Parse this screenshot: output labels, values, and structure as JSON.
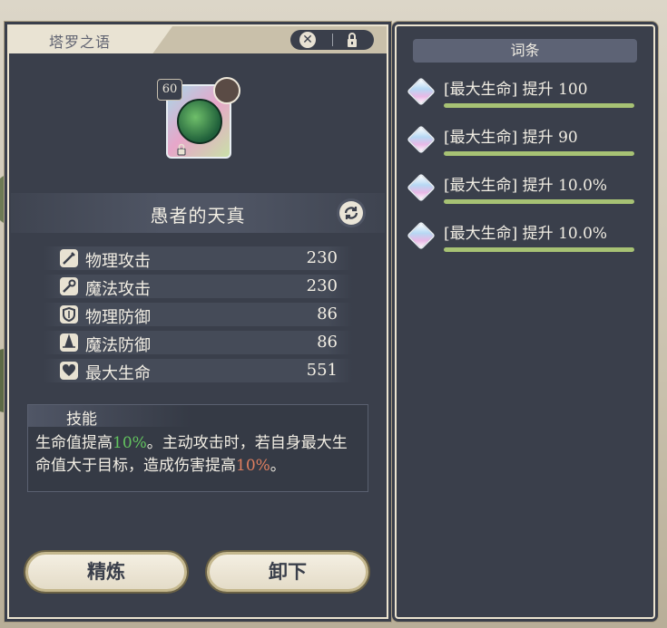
{
  "item": {
    "category": "塔罗之语",
    "level": "60",
    "name": "愚者的天真"
  },
  "stats": [
    {
      "icon": "sword-icon",
      "label": "物理攻击",
      "value": "230"
    },
    {
      "icon": "staff-icon",
      "label": "魔法攻击",
      "value": "230"
    },
    {
      "icon": "shield-icon",
      "label": "物理防御",
      "value": "86"
    },
    {
      "icon": "witch-hat-icon",
      "label": "魔法防御",
      "value": "86"
    },
    {
      "icon": "heart-icon",
      "label": "最大生命",
      "value": "551"
    }
  ],
  "skill": {
    "title": "技能",
    "desc_part1": "生命值提高",
    "desc_hl1": "10%",
    "desc_part2": "。主动攻击时，若自身最大生命值大于目标，造成伤害提高",
    "desc_hl2": "10%",
    "desc_part3": "。"
  },
  "buttons": {
    "refine": "精炼",
    "unequip": "卸下"
  },
  "affixes": {
    "header": "词条",
    "items": [
      {
        "text": "[最大生命] 提升 100",
        "fill": 1.0
      },
      {
        "text": "[最大生命] 提升 90",
        "fill": 1.0
      },
      {
        "text": "[最大生命] 提升 10.0%",
        "fill": 1.0
      },
      {
        "text": "[最大生命] 提升 10.0%",
        "fill": 1.0
      }
    ]
  },
  "colors": {
    "panel": "#3a3f4b",
    "highlight_green": "#63c35f",
    "highlight_red": "#e07f5f",
    "affix_bar": "#a7c274"
  }
}
